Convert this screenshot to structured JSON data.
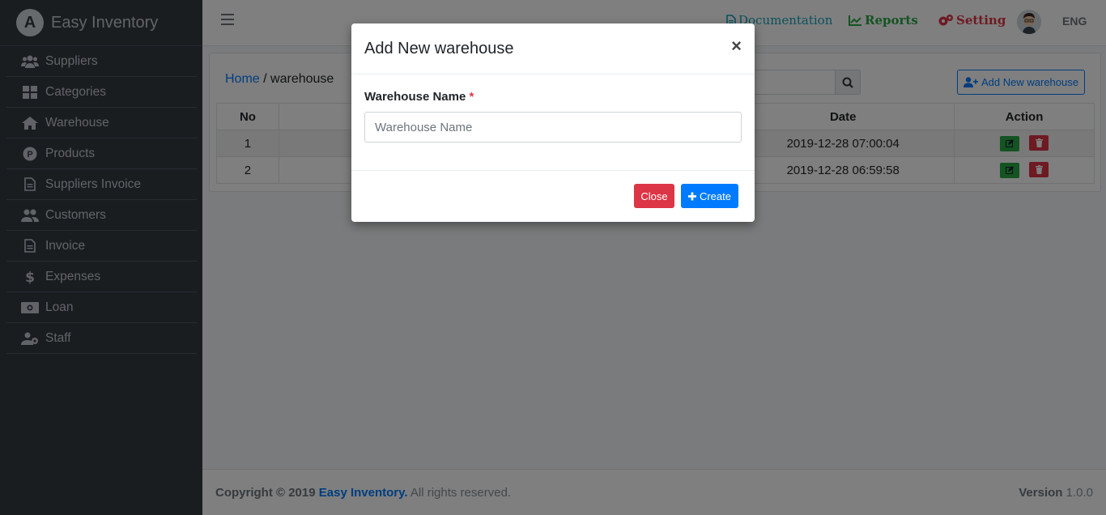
{
  "app": {
    "name": "Easy Inventory",
    "logo_letter": "A"
  },
  "sidebar": {
    "items": [
      {
        "label": "Suppliers",
        "icon": "users-icon"
      },
      {
        "label": "Categories",
        "icon": "grid-icon"
      },
      {
        "label": "Warehouse",
        "icon": "home-icon"
      },
      {
        "label": "Products",
        "icon": "product-icon"
      },
      {
        "label": "Suppliers Invoice",
        "icon": "file-icon"
      },
      {
        "label": "Customers",
        "icon": "customers-icon"
      },
      {
        "label": "Invoice",
        "icon": "file-icon"
      },
      {
        "label": "Expenses",
        "icon": "dollar-icon"
      },
      {
        "label": "Loan",
        "icon": "money-icon"
      },
      {
        "label": "Staff",
        "icon": "staff-icon"
      }
    ]
  },
  "topbar": {
    "documentation": "Documentation",
    "reports": "Reports",
    "setting": "Setting",
    "language": "ENG"
  },
  "breadcrumb": {
    "home": "Home",
    "separator": " / ",
    "current": "warehouse"
  },
  "toolbar": {
    "add_label": "Add New warehouse"
  },
  "table": {
    "headers": {
      "no": "No",
      "date": "Date",
      "action": "Action"
    },
    "rows": [
      {
        "no": "1",
        "date": "2019-12-28 07:00:04"
      },
      {
        "no": "2",
        "date": "2019-12-28 06:59:58"
      }
    ]
  },
  "footer": {
    "copyright_prefix": "Copyright © 2019 ",
    "brand": "Easy Inventory.",
    "suffix": " All rights reserved.",
    "version_label": "Version",
    "version": "1.0.0"
  },
  "modal": {
    "title": "Add New warehouse",
    "close_symbol": "×",
    "field_label": "Warehouse Name",
    "required_mark": "*",
    "placeholder": "Warehouse Name",
    "close_label": "Close",
    "create_label": "Create"
  },
  "colors": {
    "primary": "#007bff",
    "danger": "#dc3545",
    "success": "#28a745",
    "info": "#17a2b8",
    "sidebar": "#343a40"
  }
}
